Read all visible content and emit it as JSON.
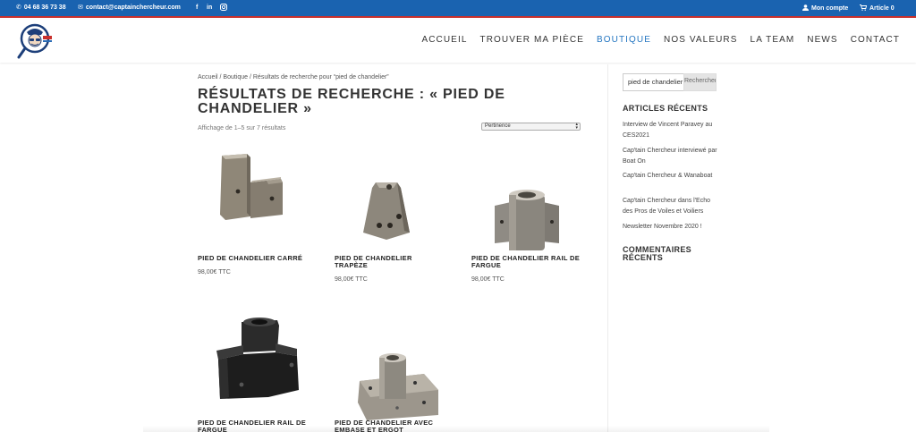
{
  "topbar": {
    "phone": "04 68 36 73 38",
    "email": "contact@captainchercheur.com",
    "facebook": "f",
    "linkedin": "in",
    "account": "Mon compte",
    "cart": "Article 0",
    "colors": {
      "bar": "#1a63b0",
      "accent_line": "#c9302c"
    }
  },
  "header": {
    "nav": [
      "ACCUEIL",
      "TROUVER MA PIÈCE",
      "BOUTIQUE",
      "NOS VALEURS",
      "LA TEAM",
      "NEWS",
      "CONTACT"
    ],
    "active": "BOUTIQUE",
    "active_color": "#2476c1"
  },
  "main": {
    "breadcrumb": "Accueil / Boutique / Résultats de recherche pour “pied de chandelier”",
    "title": "RÉSULTATS DE RECHERCHE : « PIED DE CHANDELIER »",
    "result_count": "Affichage de 1–5 sur 7 résultats",
    "sort": "Pertinence",
    "products": [
      {
        "name": "PIED DE CHANDELIER CARRÉ",
        "price": "98,00€ TTC"
      },
      {
        "name": "PIED DE CHANDELIER TRAPÈZE",
        "price": "98,00€ TTC"
      },
      {
        "name": "PIED DE CHANDELIER RAIL DE FARGUE",
        "price": "98,00€ TTC"
      },
      {
        "name": "PIED DE CHANDELIER RAIL DE FARGUE",
        "price": ""
      },
      {
        "name": "PIED DE CHANDELIER AVEC EMBASE ET ERGOT",
        "price": ""
      }
    ]
  },
  "sidebar": {
    "search_value": "pied de chandelier",
    "search_button": "Rechercher",
    "recent_articles_title": "ARTICLES RÉCENTS",
    "articles": [
      "Interview de Vincent Paravey au CES2021",
      "Cap'tain Chercheur interviewé par Boat On",
      "Cap'tain Chercheur & Wanaboat",
      "Cap'tain Chercheur dans l'Echo des Pros de Voiles et Voiliers",
      "Newsletter Novembre 2020 !"
    ],
    "recent_comments_title": "COMMENTAIRES RÉCENTS"
  }
}
